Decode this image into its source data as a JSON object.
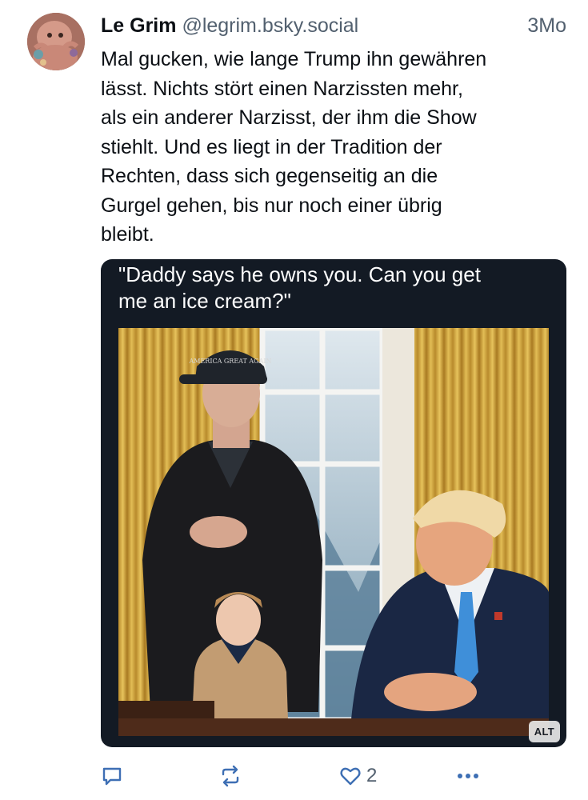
{
  "post": {
    "author_name": "Le Grim",
    "author_handle": "@legrim.bsky.social",
    "timestamp": "3Mo",
    "text_lines": [
      "Mal gucken, wie lange Trump ihn gewähren",
      "lässt. Nichts stört einen Narzissten mehr,",
      "als ein anderer Narzisst, der ihm die Show",
      "stiehlt. Und es liegt in der Tradition der",
      "Rechten, dass sich gegenseitig an die",
      "Gurgel gehen, bis nur noch einer übrig",
      "bleibt."
    ]
  },
  "media": {
    "caption_lines": [
      "\"Daddy says he owns you. Can you get",
      "me an ice cream?\""
    ],
    "cap_text": "AMERICA GREAT AGAIN",
    "alt_badge": "ALT"
  },
  "actions": {
    "reply_icon": "reply-icon",
    "repost_icon": "repost-icon",
    "like_icon": "heart-icon",
    "like_count": "2",
    "more_icon": "more-dots-icon"
  },
  "colors": {
    "text": "#0b0f14",
    "muted": "#52606f",
    "card_bg": "#131a24"
  }
}
